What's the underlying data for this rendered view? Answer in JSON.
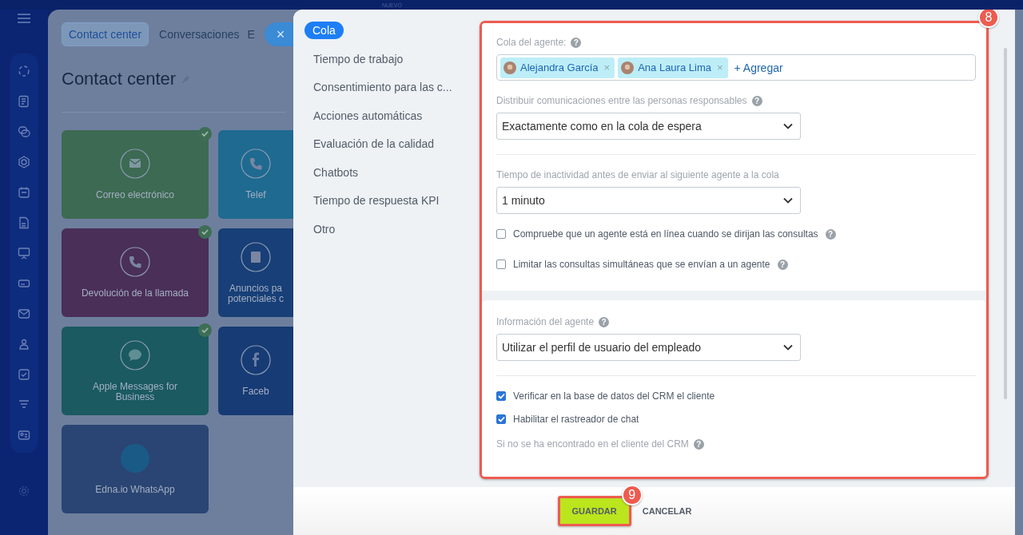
{
  "top_bar": {
    "label": "NUEVO"
  },
  "background_page": {
    "tabs": [
      {
        "label": "Contact center",
        "selected": true
      },
      {
        "label": "Conversaciones",
        "selected": false
      },
      {
        "label": "E",
        "selected": false
      }
    ],
    "title": "Contact center",
    "tiles": [
      {
        "kind": "mail",
        "label": "Correo electrónico",
        "connected": true,
        "color": "#3d6a52"
      },
      {
        "kind": "phone",
        "label": "Telef",
        "connected": false,
        "color": "#1f6a90"
      },
      {
        "kind": "phone",
        "label": "Devolución de la llamada",
        "connected": true,
        "color": "#4a2f58"
      },
      {
        "kind": "form",
        "label": "Anuncios pa potenciales c",
        "connected": false,
        "color": "#183f77"
      },
      {
        "kind": "chat",
        "label": "Apple Messages for Business",
        "connected": true,
        "color": "#1a5a60"
      },
      {
        "kind": "facebook",
        "label": "Faceb",
        "connected": false,
        "color": "#173b74"
      },
      {
        "kind": "logo",
        "label": "Edna.io WhatsApp",
        "connected": false,
        "color": "#2a4573"
      }
    ]
  },
  "close_button": {
    "label": "×"
  },
  "settings_nav": [
    {
      "label": "Cola",
      "selected": true
    },
    {
      "label": "Tiempo de trabajo",
      "selected": false
    },
    {
      "label": "Consentimiento para las c...",
      "selected": false
    },
    {
      "label": "Acciones automáticas",
      "selected": false
    },
    {
      "label": "Evaluación de la calidad",
      "selected": false
    },
    {
      "label": "Chatbots",
      "selected": false
    },
    {
      "label": "Tiempo de respuesta KPI",
      "selected": false
    },
    {
      "label": "Otro",
      "selected": false
    }
  ],
  "form": {
    "sections": [
      {
        "fields": [
          {
            "kind": "tags",
            "label": "Cola del agente:",
            "help": "?",
            "tags": [
              {
                "name": "Alejandra García",
                "remove": "×"
              },
              {
                "name": "Ana Laura Lima",
                "remove": "×"
              }
            ],
            "add": "+ Agregar"
          },
          {
            "kind": "select",
            "label": "Distribuir comunicaciones entre las personas responsables",
            "help": "?",
            "value": "Exactamente como en la cola de espera"
          },
          {
            "kind": "divider"
          },
          {
            "kind": "select",
            "label": "Tiempo de inactividad antes de enviar al siguiente agente a la cola",
            "value": "1 minuto"
          },
          {
            "kind": "checkbox",
            "label": "Compruebe que un agente está en línea cuando se dirijan las consultas",
            "help": "?",
            "checked": false
          },
          {
            "kind": "checkbox",
            "label": "Limitar las consultas simultáneas que se envían a un agente",
            "help": "?",
            "checked": false
          }
        ]
      },
      {
        "fields": [
          {
            "kind": "select",
            "label": "Información del agente",
            "help": "?",
            "value": "Utilizar el perfil de usuario del empleado"
          },
          {
            "kind": "divider"
          },
          {
            "kind": "checkbox",
            "label": "Verificar en la base de datos del CRM el cliente",
            "checked": true
          },
          {
            "kind": "checkbox",
            "label": "Habilitar el rastreador de chat",
            "checked": true
          },
          {
            "kind": "heading",
            "label": "Si no se ha encontrado en el cliente del CRM",
            "help": "?"
          }
        ]
      }
    ]
  },
  "annotations": [
    {
      "label": "8"
    },
    {
      "label": "9"
    }
  ],
  "footer": {
    "save": "GUARDAR",
    "cancel": "CANCELAR"
  }
}
